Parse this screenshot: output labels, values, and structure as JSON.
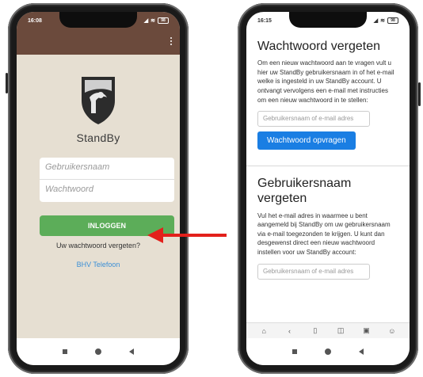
{
  "left_phone": {
    "status": {
      "time": "16:08",
      "battery": "98"
    },
    "logo": {
      "name": "StandBy"
    },
    "login": {
      "username_placeholder": "Gebruikersnaam",
      "password_placeholder": "Wachtwoord",
      "login_button": "INLOGGEN"
    },
    "links": {
      "forgot_password": "Uw wachtwoord vergeten?",
      "bhv_phone": "BHV Telefoon"
    }
  },
  "right_phone": {
    "status": {
      "time": "16:15",
      "battery": "98"
    },
    "forgot_password": {
      "title": "Wachtwoord vergeten",
      "description": "Om een nieuw wachtwoord aan te vragen vult u hier uw StandBy gebruikersnaam in of het e-mail welke is ingesteld in uw StandBy account. U ontvangt vervolgens een e-mail met instructies om een nieuw wachtwoord in te stellen:",
      "input_placeholder": "Gebruikersnaam of e-mail adres",
      "button": "Wachtwoord opvragen"
    },
    "forgot_username": {
      "title": "Gebruikersnaam vergeten",
      "description": "Vul het e-mail adres in waarmee u bent aangemeld bij StandBy om uw gebruikersnaam via e-mail toegezonden te krijgen. U kunt dan desgewenst direct een nieuw wachtwoord instellen voor uw StandBy account:",
      "input_placeholder": "Gebruikersnaam of e-mail adres"
    },
    "browser_icons": [
      "home-icon",
      "back-icon",
      "book-icon",
      "shield-icon",
      "tabs-icon",
      "profile-icon"
    ]
  },
  "colors": {
    "app_brown": "#6b4a3c",
    "app_background": "#e6dfd2",
    "login_green": "#5cad59",
    "link_blue": "#3b8fd6",
    "button_blue": "#1a7ee3",
    "arrow_red": "#e3201b"
  }
}
